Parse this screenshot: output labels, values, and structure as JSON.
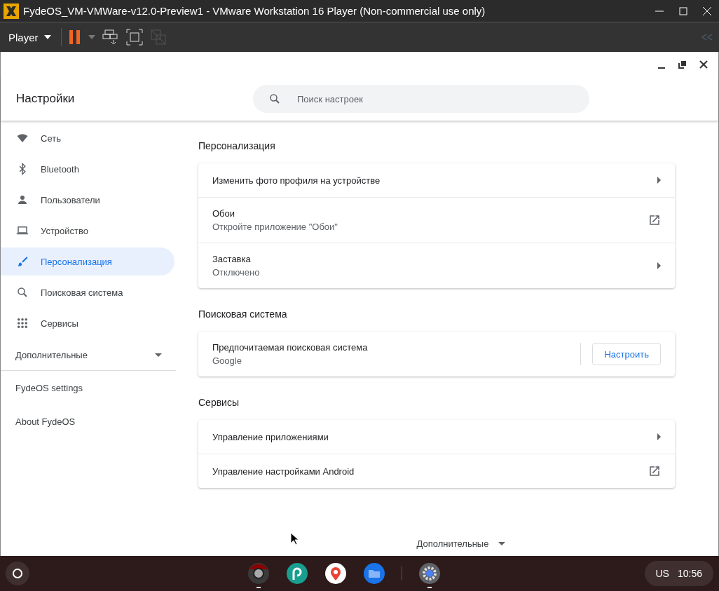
{
  "window": {
    "title": "FydeOS_VM-VMWare-v12.0-Preview1 - VMware Workstation 16 Player (Non-commercial use only)"
  },
  "toolbar": {
    "player_menu": "Player"
  },
  "settings": {
    "title": "Настройки",
    "search": {
      "placeholder": "Поиск настроек"
    },
    "sidebar": {
      "items": [
        {
          "label": "Сеть",
          "selected": false
        },
        {
          "label": "Bluetooth",
          "selected": false
        },
        {
          "label": "Пользователи",
          "selected": false
        },
        {
          "label": "Устройство",
          "selected": false
        },
        {
          "label": "Персонализация",
          "selected": true
        },
        {
          "label": "Поисковая система",
          "selected": false
        },
        {
          "label": "Сервисы",
          "selected": false
        }
      ],
      "advanced": "Дополнительные",
      "links": [
        "FydeOS settings",
        "About FydeOS"
      ]
    },
    "sections": [
      {
        "title": "Персонализация",
        "rows": [
          {
            "kind": "arrow",
            "label": "Изменить фото профиля на устройстве"
          },
          {
            "kind": "external",
            "label": "Обои",
            "sublabel": "Откройте приложение \"Обои\""
          },
          {
            "kind": "arrow",
            "label": "Заставка",
            "sublabel": "Отключено"
          }
        ]
      },
      {
        "title": "Поисковая система",
        "rows": [
          {
            "kind": "button",
            "label": "Предпочитаемая поисковая система",
            "sublabel": "Google",
            "button": "Настроить"
          }
        ]
      },
      {
        "title": "Сервисы",
        "rows": [
          {
            "kind": "arrow",
            "label": "Управление приложениями"
          },
          {
            "kind": "external",
            "label": "Управление настройками Android"
          }
        ]
      }
    ],
    "advanced_footer": "Дополнительные"
  },
  "shelf": {
    "apps": [
      {
        "running": true
      },
      {
        "running": false
      },
      {
        "running": false
      },
      {
        "running": false
      },
      {
        "running": true
      }
    ],
    "status": {
      "ime": "US",
      "time": "10:56"
    }
  }
}
